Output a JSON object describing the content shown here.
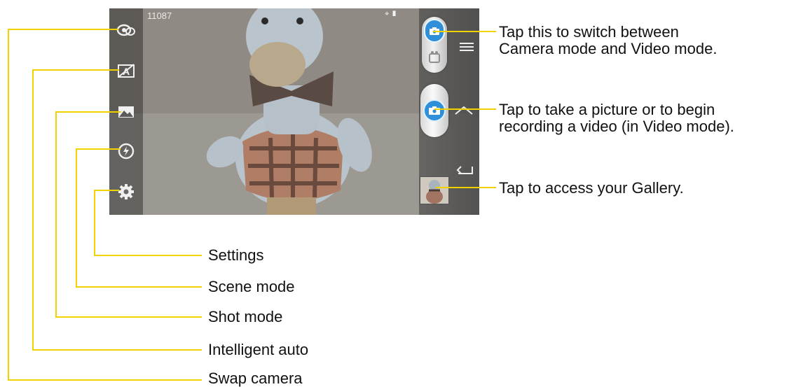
{
  "screen": {
    "counter": "11087",
    "status_icons": "⌖ ▮"
  },
  "left_rail_icons": [
    {
      "name": "swap-camera-icon"
    },
    {
      "name": "intelligent-auto-icon"
    },
    {
      "name": "shot-mode-icon"
    },
    {
      "name": "scene-mode-icon"
    },
    {
      "name": "settings-icon"
    }
  ],
  "callouts": {
    "mode_switch": [
      "Tap this to switch between",
      "Camera mode and Video mode."
    ],
    "shutter": [
      "Tap to take a picture or to begin",
      "recording a video (in Video mode)."
    ],
    "gallery": "Tap to access your Gallery.",
    "settings": "Settings",
    "scene_mode": "Scene mode",
    "shot_mode": "Shot mode",
    "intelligent_auto": "Intelligent auto",
    "swap_camera": "Swap camera"
  },
  "colors": {
    "callout_line": "#f2d100",
    "accent_blue": "#2f8fd8"
  }
}
